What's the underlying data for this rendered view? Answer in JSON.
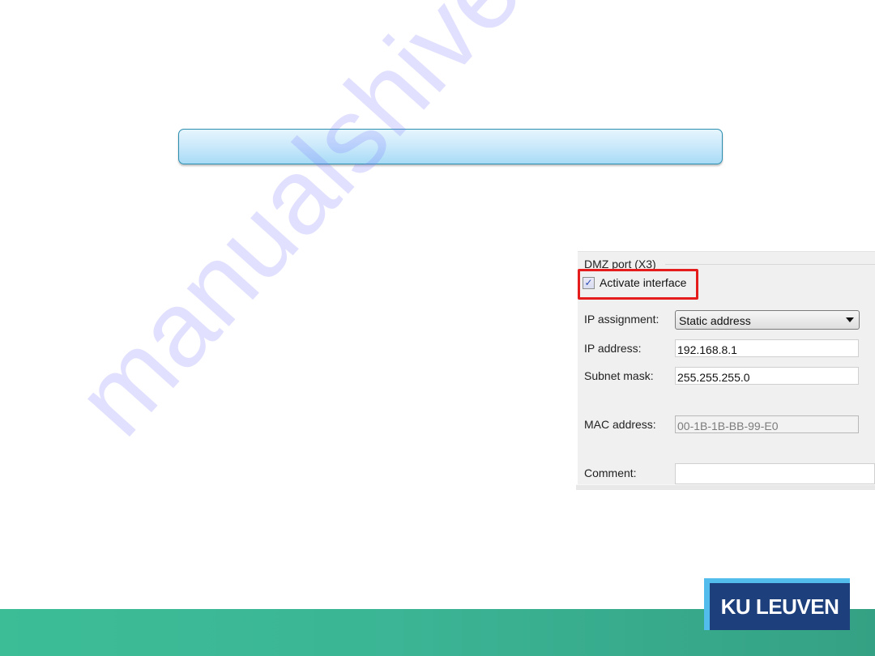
{
  "watermark": "manualshive.com",
  "panel": {
    "group_title": "DMZ port (X3)",
    "activate_interface": {
      "label": "Activate interface",
      "checked": true,
      "check_glyph": "✓"
    },
    "ip_assignment": {
      "label": "IP assignment:",
      "value": "Static address"
    },
    "ip_address": {
      "label": "IP address:",
      "value": "192.168.8.1"
    },
    "subnet_mask": {
      "label": "Subnet mask:",
      "value": "255.255.255.0"
    },
    "mac_address": {
      "label": "MAC address:",
      "value": "00-1B-1B-BB-99-E0"
    },
    "comment": {
      "label": "Comment:",
      "value": ""
    }
  },
  "highlight_color": "#e41c1c",
  "logo": {
    "text": "KU LEUVEN"
  },
  "colors": {
    "footer": "#3bb595",
    "logo_bg": "#1d3f7c",
    "logo_accent": "#52bdec"
  }
}
